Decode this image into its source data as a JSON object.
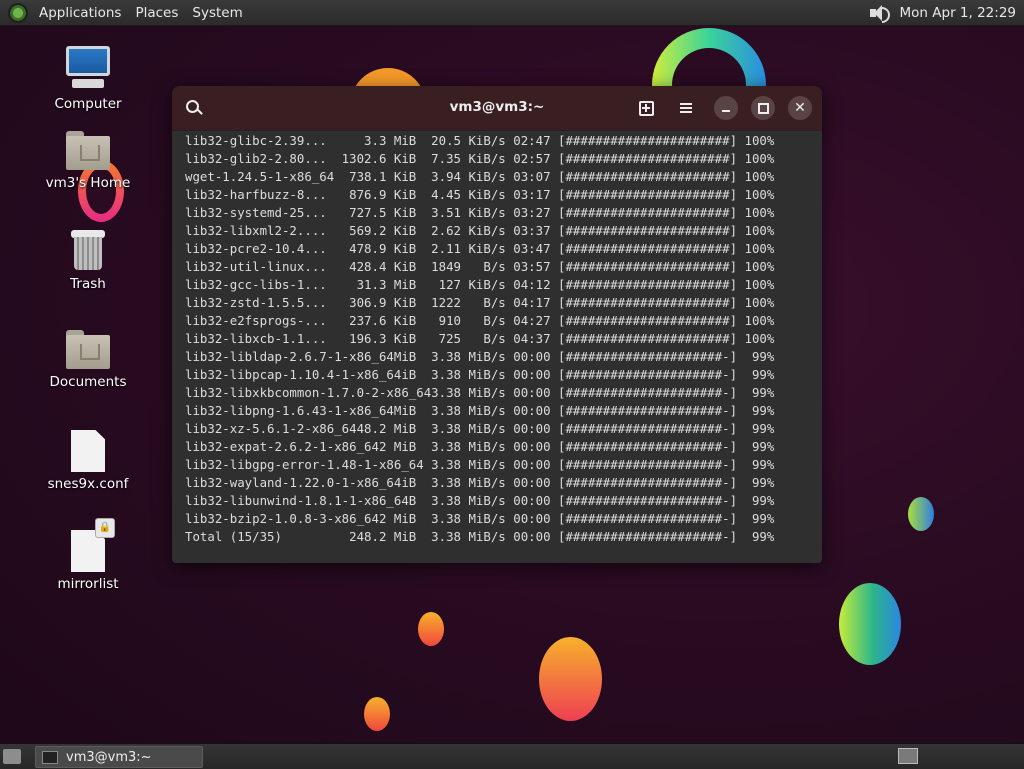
{
  "top_panel": {
    "menus": [
      "Applications",
      "Places",
      "System"
    ],
    "clock": "Mon Apr 1, 22:29"
  },
  "desktop_icons": [
    {
      "label": "Computer",
      "icon": "computer-icon"
    },
    {
      "label": "vm3's Home",
      "icon": "home-folder-icon"
    },
    {
      "label": "Trash",
      "icon": "trash-icon"
    },
    {
      "label": "Documents",
      "icon": "documents-folder-icon"
    },
    {
      "label": "snes9x.conf",
      "icon": "text-file-icon"
    },
    {
      "label": "mirrorlist",
      "icon": "text-file-icon"
    }
  ],
  "terminal": {
    "title": "vm3@vm3:~",
    "lines": [
      "lib32-glibc-2.39...     3.3 MiB  20.5 KiB/s 02:47 [######################] 100%",
      "lib32-glib2-2.80...  1302.6 KiB  7.35 KiB/s 02:57 [######################] 100%",
      "wget-1.24.5-1-x86_64  738.1 KiB  3.94 KiB/s 03:07 [######################] 100%",
      "lib32-harfbuzz-8...   876.9 KiB  4.45 KiB/s 03:17 [######################] 100%",
      "lib32-systemd-25...   727.5 KiB  3.51 KiB/s 03:27 [######################] 100%",
      "lib32-libxml2-2....   569.2 KiB  2.62 KiB/s 03:37 [######################] 100%",
      "lib32-pcre2-10.4...   478.9 KiB  2.11 KiB/s 03:47 [######################] 100%",
      "lib32-util-linux...   428.4 KiB  1849   B/s 03:57 [######################] 100%",
      "lib32-gcc-libs-1...    31.3 MiB   127 KiB/s 04:12 [######################] 100%",
      "lib32-zstd-1.5.5...   306.9 KiB  1222   B/s 04:17 [######################] 100%",
      "lib32-e2fsprogs-...   237.6 KiB   910   B/s 04:27 [######################] 100%",
      "lib32-libxcb-1.1...   196.3 KiB   725   B/s 04:37 [######################] 100%",
      "lib32-libldap-2.6.7-1-x86_64MiB  3.38 MiB/s 00:00 [#####################-]  99%",
      "lib32-libpcap-1.10.4-1-x86_64iB  3.38 MiB/s 00:00 [#####################-]  99%",
      "lib32-libxkbcommon-1.7.0-2-x86_643.38 MiB/s 00:00 [#####################-]  99%",
      "lib32-libpng-1.6.43-1-x86_64MiB  3.38 MiB/s 00:00 [#####################-]  99%",
      "lib32-xz-5.6.1-2-x86_6448.2 MiB  3.38 MiB/s 00:00 [#####################-]  99%",
      "lib32-expat-2.6.2-1-x86_642 MiB  3.38 MiB/s 00:00 [#####################-]  99%",
      "lib32-libgpg-error-1.48-1-x86_64 3.38 MiB/s 00:00 [#####################-]  99%",
      "lib32-wayland-1.22.0-1-x86_64iB  3.38 MiB/s 00:00 [#####################-]  99%",
      "lib32-libunwind-1.8.1-1-x86_64B  3.38 MiB/s 00:00 [#####################-]  99%",
      "lib32-bzip2-1.0.8-3-x86_642 MiB  3.38 MiB/s 00:00 [#####################-]  99%",
      "Total (15/35)         248.2 MiB  3.38 MiB/s 00:00 [#####################-]  99%"
    ]
  },
  "taskbar": {
    "window_button": "vm3@vm3:~"
  },
  "colors": {
    "headerbar": "#3a1f22",
    "terminal_bg": "#2f2f2f",
    "panel": "#2b2b2b"
  }
}
